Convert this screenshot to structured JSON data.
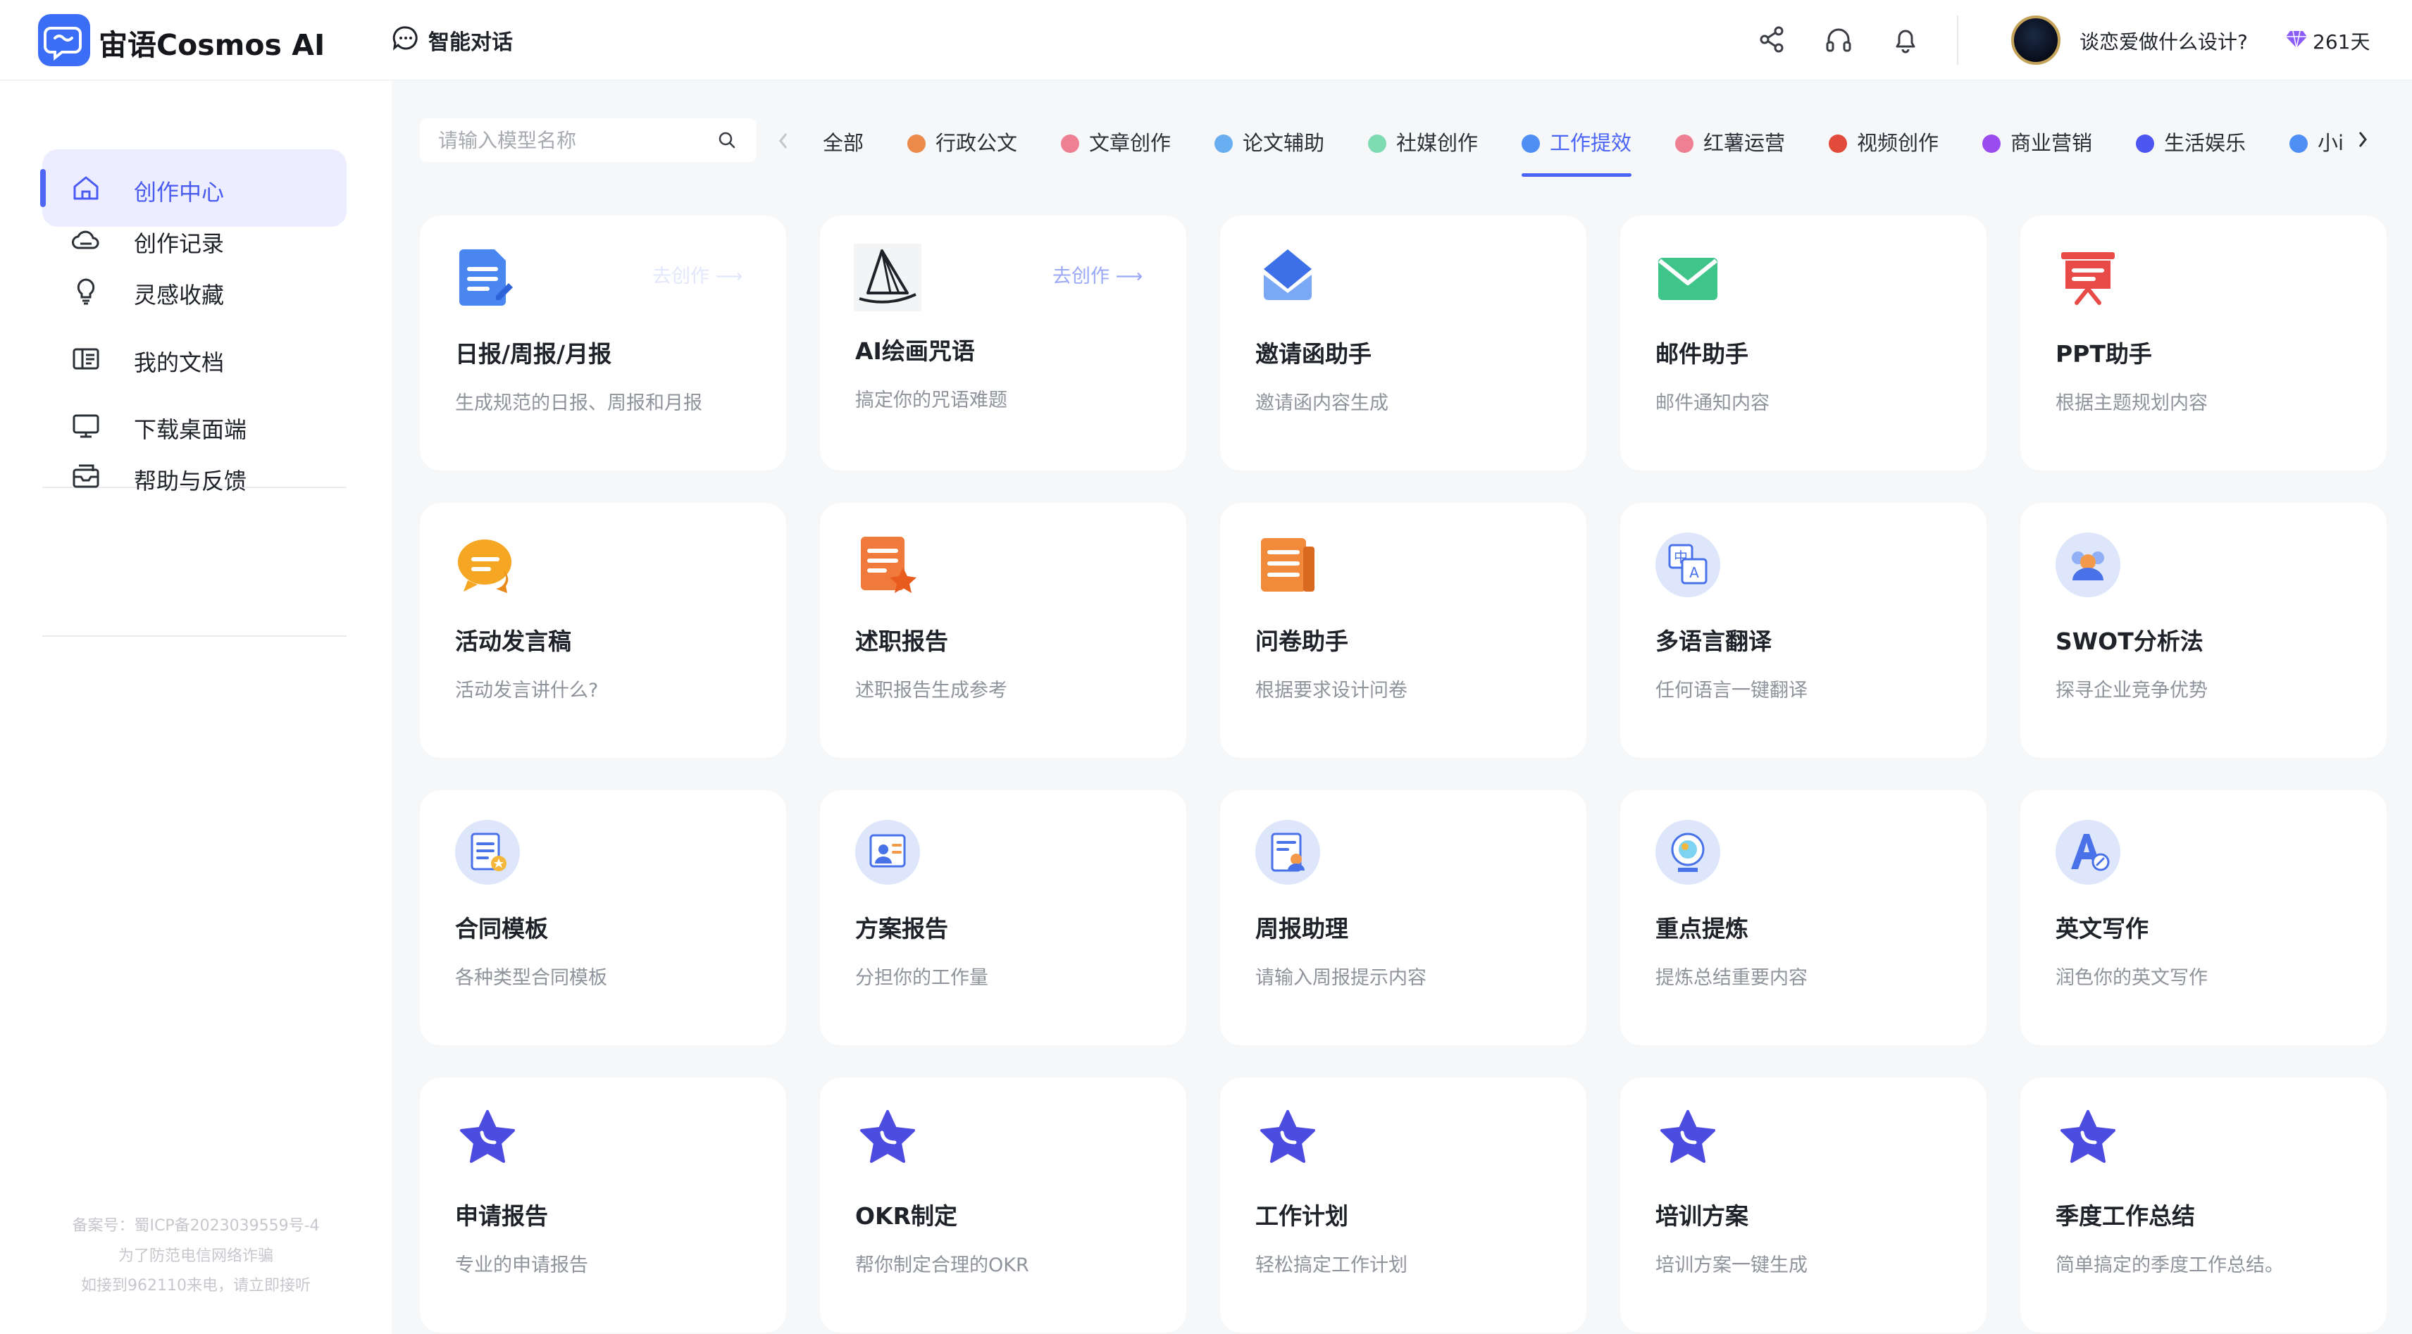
{
  "header": {
    "app_name": "宙语Cosmos AI",
    "chat_label": "智能对话",
    "user_name": "谈恋爱做什么设计?",
    "days": "261天"
  },
  "sidebar": {
    "items": [
      {
        "label": "创作中心",
        "icon": "home-icon"
      },
      {
        "label": "创作记录",
        "icon": "cloud-icon"
      },
      {
        "label": "灵感收藏",
        "icon": "lightbulb-icon"
      },
      {
        "label": "我的文档",
        "icon": "document-book-icon"
      },
      {
        "label": "下载桌面端",
        "icon": "monitor-icon"
      },
      {
        "label": "帮助与反馈",
        "icon": "mail-feedback-icon"
      }
    ],
    "icp": [
      "备案号：蜀ICP备2023039559号-4",
      "为了防范电信网络诈骗",
      "如接到962110来电，请立即接听"
    ]
  },
  "filters": {
    "search_placeholder": "请输入模型名称",
    "tabs": [
      {
        "label": "全部",
        "color": null
      },
      {
        "label": "行政公文",
        "color": "#ec8a4a"
      },
      {
        "label": "文章创作",
        "color": "#ef7f92"
      },
      {
        "label": "论文辅助",
        "color": "#6aaef2"
      },
      {
        "label": "社媒创作",
        "color": "#7fdbb2"
      },
      {
        "label": "工作提效",
        "color": "#4f8ef5"
      },
      {
        "label": "红薯运营",
        "color": "#ef7f92"
      },
      {
        "label": "视频创作",
        "color": "#e24a3b"
      },
      {
        "label": "商业营销",
        "color": "#9b4cf0"
      },
      {
        "label": "生活娱乐",
        "color": "#4c56f0"
      },
      {
        "label": "小i",
        "color": "#4f8ef5"
      }
    ],
    "active_tab": "工作提效"
  },
  "cards": [
    {
      "title": "日报/周报/月报",
      "desc": "生成规范的日报、周报和月报",
      "icon": "report-doc-icon",
      "go": "去创作 ⟶"
    },
    {
      "title": "AI绘画咒语",
      "desc": "搞定你的咒语难题",
      "icon": "sailboat-drawing-icon",
      "go": "去创作 ⟶"
    },
    {
      "title": "邀请函助手",
      "desc": "邀请函内容生成",
      "icon": "invitation-envelope-icon"
    },
    {
      "title": "邮件助手",
      "desc": "邮件通知内容",
      "icon": "email-icon"
    },
    {
      "title": "PPT助手",
      "desc": "根据主题规划内容",
      "icon": "presentation-board-icon"
    },
    {
      "title": "活动发言稿",
      "desc": "活动发言讲什么?",
      "icon": "speech-bubble-icon"
    },
    {
      "title": "述职报告",
      "desc": "述职报告生成参考",
      "icon": "star-document-icon"
    },
    {
      "title": "问卷助手",
      "desc": "根据要求设计问卷",
      "icon": "questionnaire-icon"
    },
    {
      "title": "多语言翻译",
      "desc": "任何语言一键翻译",
      "icon": "translate-icon"
    },
    {
      "title": "SWOT分析法",
      "desc": "探寻企业竞争优势",
      "icon": "team-analysis-icon"
    },
    {
      "title": "合同模板",
      "desc": "各种类型合同模板",
      "icon": "contract-icon"
    },
    {
      "title": "方案报告",
      "desc": "分担你的工作量",
      "icon": "plan-report-icon"
    },
    {
      "title": "周报助理",
      "desc": "请输入周报提示内容",
      "icon": "weekly-report-icon"
    },
    {
      "title": "重点提炼",
      "desc": "提炼总结重要内容",
      "icon": "highlight-extract-icon"
    },
    {
      "title": "英文写作",
      "desc": "润色你的英文写作",
      "icon": "english-writing-icon"
    },
    {
      "title": "申请报告",
      "desc": "专业的申请报告",
      "icon": "star-icon"
    },
    {
      "title": "OKR制定",
      "desc": "帮你制定合理的OKR",
      "icon": "star-icon"
    },
    {
      "title": "工作计划",
      "desc": "轻松搞定工作计划",
      "icon": "star-icon"
    },
    {
      "title": "培训方案",
      "desc": "培训方案一键生成",
      "icon": "star-icon"
    },
    {
      "title": "季度工作总结",
      "desc": "简单搞定的季度工作总结。",
      "icon": "star-icon"
    }
  ]
}
